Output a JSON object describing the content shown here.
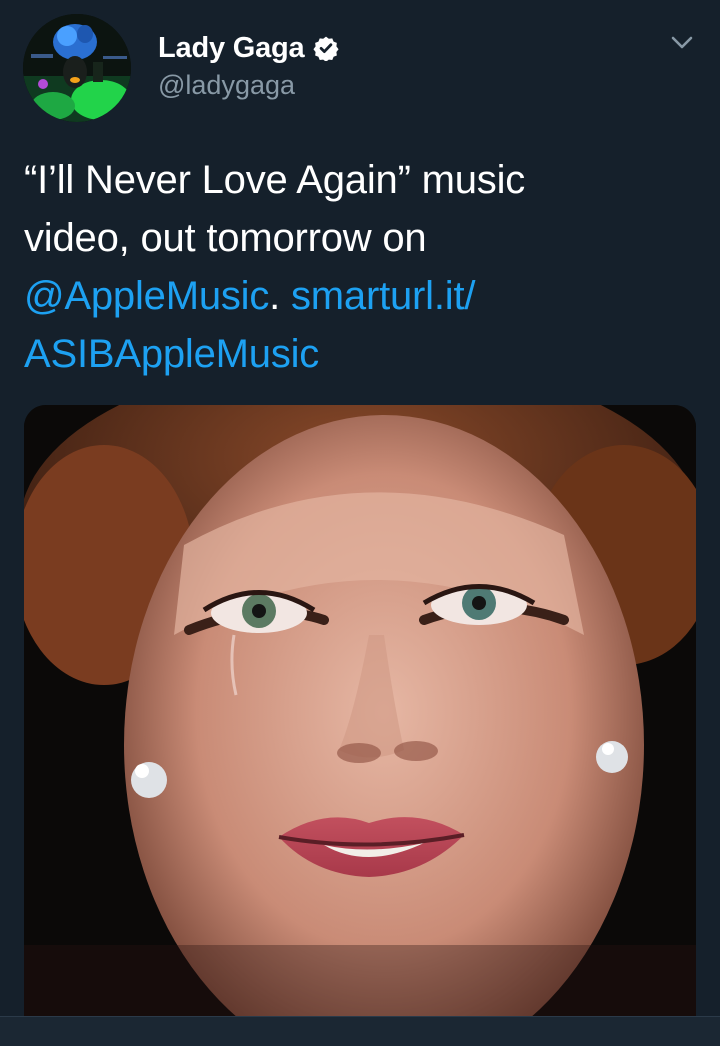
{
  "user": {
    "display_name": "Lady Gaga",
    "handle": "@ladygaga",
    "verified": true,
    "avatar_icon": "profile-avatar"
  },
  "tweet": {
    "text_lines": [
      "“I’ll Never Love Again” music",
      "video, out tomorrow on"
    ],
    "mention": "@AppleMusic",
    "after_mention": ". ",
    "link_part1": "smarturl.it/",
    "link_part2": "ASIBAppleMusic"
  },
  "icons": {
    "verified": "verified-badge-icon",
    "menu": "chevron-down-icon"
  },
  "colors": {
    "background": "#15202b",
    "link": "#1da1f2",
    "secondary_text": "#8899a6"
  }
}
